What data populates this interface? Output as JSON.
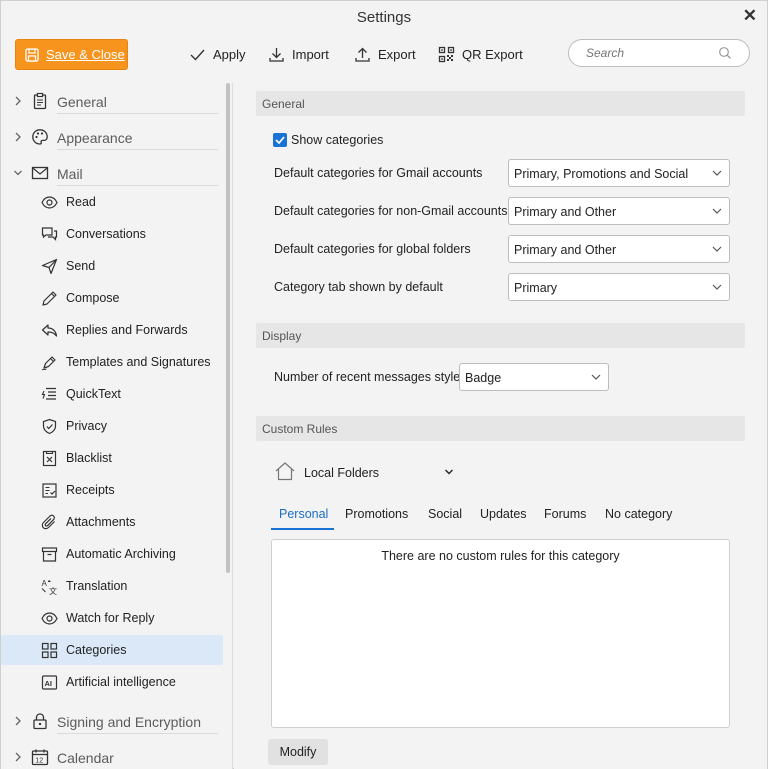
{
  "window": {
    "title": "Settings"
  },
  "toolbar": {
    "save_label": "Save & Close",
    "apply_label": "Apply",
    "import_label": "Import",
    "export_label": "Export",
    "qr_export_label": "QR Export",
    "search_placeholder": "Search"
  },
  "sidebar": {
    "sections": {
      "general": "General",
      "appearance": "Appearance",
      "mail": "Mail",
      "signing": "Signing and Encryption",
      "calendar": "Calendar"
    },
    "mail_items": [
      {
        "label": "Read",
        "icon": "eye-icon"
      },
      {
        "label": "Conversations",
        "icon": "conversations-icon"
      },
      {
        "label": "Send",
        "icon": "send-icon"
      },
      {
        "label": "Compose",
        "icon": "pencil-icon"
      },
      {
        "label": "Replies and Forwards",
        "icon": "reply-icon"
      },
      {
        "label": "Templates and Signatures",
        "icon": "signature-pen-icon"
      },
      {
        "label": "QuickText",
        "icon": "quicktext-icon"
      },
      {
        "label": "Privacy",
        "icon": "shield-icon"
      },
      {
        "label": "Blacklist",
        "icon": "blacklist-icon"
      },
      {
        "label": "Receipts",
        "icon": "receipt-icon"
      },
      {
        "label": "Attachments",
        "icon": "paperclip-icon"
      },
      {
        "label": "Automatic Archiving",
        "icon": "archive-icon"
      },
      {
        "label": "Translation",
        "icon": "translate-icon"
      },
      {
        "label": "Watch for Reply",
        "icon": "watch-eye-icon"
      },
      {
        "label": "Categories",
        "icon": "categories-icon",
        "active": true
      },
      {
        "label": "Artificial intelligence",
        "icon": "ai-icon"
      }
    ]
  },
  "main": {
    "general": {
      "header": "General",
      "show_categories_label": "Show categories",
      "show_categories_checked": true,
      "rows": [
        {
          "label": "Default categories for Gmail accounts",
          "value": "Primary, Promotions and Social"
        },
        {
          "label": "Default categories for non-Gmail accounts",
          "value": "Primary and Other"
        },
        {
          "label": "Default categories for global folders",
          "value": "Primary and Other"
        },
        {
          "label": "Category tab shown by default",
          "value": "Primary"
        }
      ]
    },
    "display": {
      "header": "Display",
      "recent_style_label": "Number of recent messages style",
      "recent_style_value": "Badge"
    },
    "custom_rules": {
      "header": "Custom Rules",
      "folder_label": "Local Folders",
      "tabs": [
        "Personal",
        "Promotions",
        "Social",
        "Updates",
        "Forums",
        "No category"
      ],
      "active_tab": "Personal",
      "empty_message": "There are no custom rules for this category",
      "modify_label": "Modify"
    }
  },
  "colors": {
    "accent": "#f7941d",
    "selection": "#dae8f8",
    "link_blue": "#1a73d4"
  }
}
